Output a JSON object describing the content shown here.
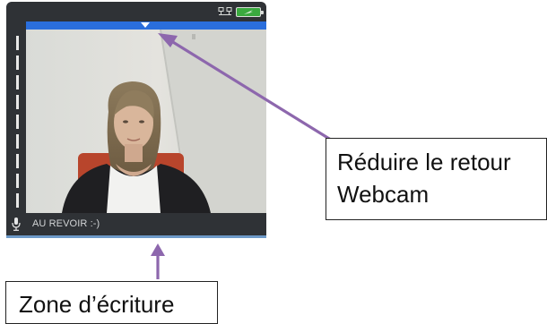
{
  "webcam": {
    "chat_message": "AU REVOIR :-)",
    "icons": {
      "network": "network-status-icon",
      "battery": "battery-charging-icon",
      "collapse": "collapse-arrow-icon",
      "microphone": "microphone-icon"
    },
    "colors": {
      "frame": "#2f3236",
      "collapse_bar": "#2a6edc",
      "battery": "#3aa93f",
      "annotation_arrow": "#8d67ad"
    }
  },
  "annotations": {
    "reduce_label_line1": "Réduire le retour",
    "reduce_label_line2": "Webcam",
    "writing_zone_label": "Zone d’écriture"
  }
}
